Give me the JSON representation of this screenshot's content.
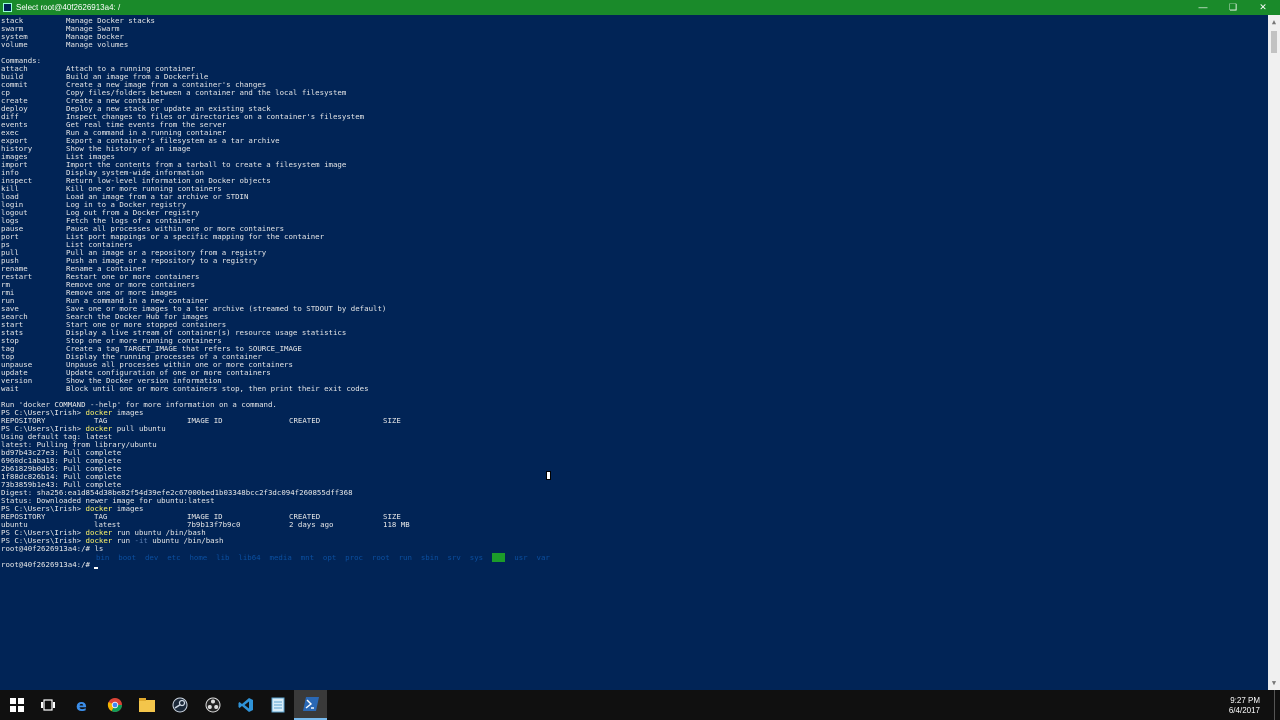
{
  "window": {
    "title": "Select root@40f2626913a4: /"
  },
  "terminal_lines": [
    [
      "stack",
      "Manage Docker stacks"
    ],
    [
      "swarm",
      "Manage Swarm"
    ],
    [
      "system",
      "Manage Docker"
    ],
    [
      "volume",
      "Manage volumes"
    ],
    [
      ""
    ],
    [
      "Commands:"
    ],
    [
      "attach",
      "Attach to a running container"
    ],
    [
      "build",
      "Build an image from a Dockerfile"
    ],
    [
      "commit",
      "Create a new image from a container's changes"
    ],
    [
      "cp",
      "Copy files/folders between a container and the local filesystem"
    ],
    [
      "create",
      "Create a new container"
    ],
    [
      "deploy",
      "Deploy a new stack or update an existing stack"
    ],
    [
      "diff",
      "Inspect changes to files or directories on a container's filesystem"
    ],
    [
      "events",
      "Get real time events from the server"
    ],
    [
      "exec",
      "Run a command in a running container"
    ],
    [
      "export",
      "Export a container's filesystem as a tar archive"
    ],
    [
      "history",
      "Show the history of an image"
    ],
    [
      "images",
      "List images"
    ],
    [
      "import",
      "Import the contents from a tarball to create a filesystem image"
    ],
    [
      "info",
      "Display system-wide information"
    ],
    [
      "inspect",
      "Return low-level information on Docker objects"
    ],
    [
      "kill",
      "Kill one or more running containers"
    ],
    [
      "load",
      "Load an image from a tar archive or STDIN"
    ],
    [
      "login",
      "Log in to a Docker registry"
    ],
    [
      "logout",
      "Log out from a Docker registry"
    ],
    [
      "logs",
      "Fetch the logs of a container"
    ],
    [
      "pause",
      "Pause all processes within one or more containers"
    ],
    [
      "port",
      "List port mappings or a specific mapping for the container"
    ],
    [
      "ps",
      "List containers"
    ],
    [
      "pull",
      "Pull an image or a repository from a registry"
    ],
    [
      "push",
      "Push an image or a repository to a registry"
    ],
    [
      "rename",
      "Rename a container"
    ],
    [
      "restart",
      "Restart one or more containers"
    ],
    [
      "rm",
      "Remove one or more containers"
    ],
    [
      "rmi",
      "Remove one or more images"
    ],
    [
      "run",
      "Run a command in a new container"
    ],
    [
      "save",
      "Save one or more images to a tar archive (streamed to STDOUT by default)"
    ],
    [
      "search",
      "Search the Docker Hub for images"
    ],
    [
      "start",
      "Start one or more stopped containers"
    ],
    [
      "stats",
      "Display a live stream of container(s) resource usage statistics"
    ],
    [
      "stop",
      "Stop one or more running containers"
    ],
    [
      "tag",
      "Create a tag TARGET_IMAGE that refers to SOURCE_IMAGE"
    ],
    [
      "top",
      "Display the running processes of a container"
    ],
    [
      "unpause",
      "Unpause all processes within one or more containers"
    ],
    [
      "update",
      "Update configuration of one or more containers"
    ],
    [
      "version",
      "Show the Docker version information"
    ],
    [
      "wait",
      "Block until one or more containers stop, then print their exit codes"
    ],
    [
      ""
    ],
    [
      "Run 'docker COMMAND --help' for more information on a command."
    ],
    [
      "PS C:\\Users\\Irish> ",
      "docker images"
    ],
    [
      "REPOSITORY",
      "TAG",
      "IMAGE ID",
      "CREATED",
      "SIZE"
    ],
    [
      "PS C:\\Users\\Irish> ",
      "docker pull ubuntu"
    ],
    [
      "Using default tag: latest"
    ],
    [
      "latest: Pulling from library/ubuntu"
    ],
    [
      "bd97b43c27e3: Pull complete"
    ],
    [
      "6960dc1aba18: Pull complete"
    ],
    [
      "2b61829b0db5: Pull complete"
    ],
    [
      "1f88dc826b14: Pull complete"
    ],
    [
      "73b3859b1e43: Pull complete"
    ],
    [
      "Digest: sha256:ea1d854d38be82f54d39efe2c67000bed1b03348bcc2f3dc094f260855dff368"
    ],
    [
      "Status: Downloaded newer image for ubuntu:latest"
    ],
    [
      "PS C:\\Users\\Irish> ",
      "docker images"
    ],
    [
      "REPOSITORY",
      "TAG",
      "IMAGE ID",
      "CREATED",
      "SIZE"
    ],
    [
      "ubuntu",
      "latest",
      "7b9b13f7b9c0",
      "2 days ago",
      "118 MB"
    ],
    [
      "PS C:\\Users\\Irish> ",
      "docker run ubuntu /bin/bash"
    ],
    [
      "PS C:\\Users\\Irish> ",
      "docker run -it ubuntu /bin/bash"
    ],
    [
      "root@40f2626913a4:/# ls"
    ],
    [
      ""
    ],
    [
      "root@40f2626913a4:/# "
    ]
  ],
  "ls_output": "bin  boot  dev  etc  home  lib  lib64  media  mnt  opt  proc  root  run  sbin  srv  sys  tmp  usr  var",
  "taskbar": {
    "apps": [
      "start-button",
      "task-view",
      "edge",
      "chrome",
      "file-explorer",
      "steam",
      "obs",
      "vs-code",
      "notepad",
      "powershell"
    ],
    "time": "9:27 PM",
    "date": "6/4/2017"
  },
  "colors": {
    "titlebar": "#1a8a2a",
    "terminal_bg": "#012456",
    "command_text": "#fff568",
    "taskbar": "#101010"
  }
}
